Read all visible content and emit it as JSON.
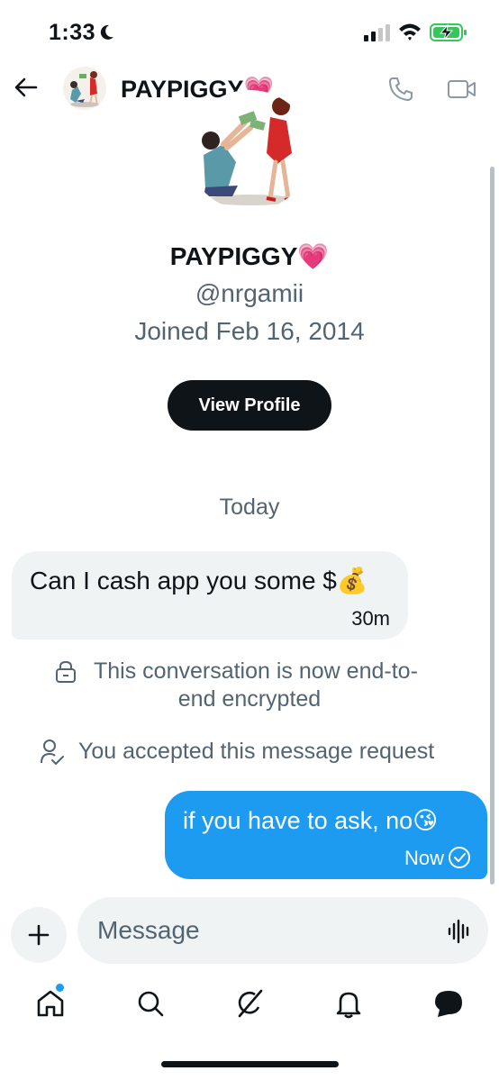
{
  "status_bar": {
    "time": "1:33",
    "icons": [
      "moon-icon",
      "signal-icon",
      "wifi-icon",
      "battery-charging-icon"
    ],
    "battery_color": "#34c759"
  },
  "header": {
    "title": "PAYPIGGY💗",
    "icons": [
      "back-arrow-icon",
      "phone-icon",
      "video-camera-icon"
    ]
  },
  "profile": {
    "name": "PAYPIGGY💗",
    "handle": "@nrgamii",
    "joined": "Joined Feb 16, 2014",
    "view_profile_label": "View Profile"
  },
  "conversation": {
    "date_separator": "Today",
    "messages": [
      {
        "direction": "incoming",
        "text": "Can I cash app you some $💰",
        "time": "30m"
      },
      {
        "direction": "outgoing",
        "text": "if you have to ask, no😘",
        "time": "Now"
      }
    ],
    "system_notes": {
      "encryption_line1": "This conversation is now end-to-",
      "encryption_line2": "end encrypted",
      "request_accepted": "You accepted this message request"
    }
  },
  "composer": {
    "placeholder": "Message",
    "icons": [
      "plus-icon",
      "voice-waveform-icon"
    ]
  },
  "tab_bar": {
    "items": [
      "home-icon",
      "search-icon",
      "grok-icon",
      "notifications-bell-icon",
      "messages-icon"
    ],
    "active_indicator_color": "#1d9bf0"
  },
  "colors": {
    "accent": "#1d9bf0",
    "text_primary": "#0f1419",
    "text_secondary": "#536471",
    "bubble_incoming": "#eff3f4"
  }
}
